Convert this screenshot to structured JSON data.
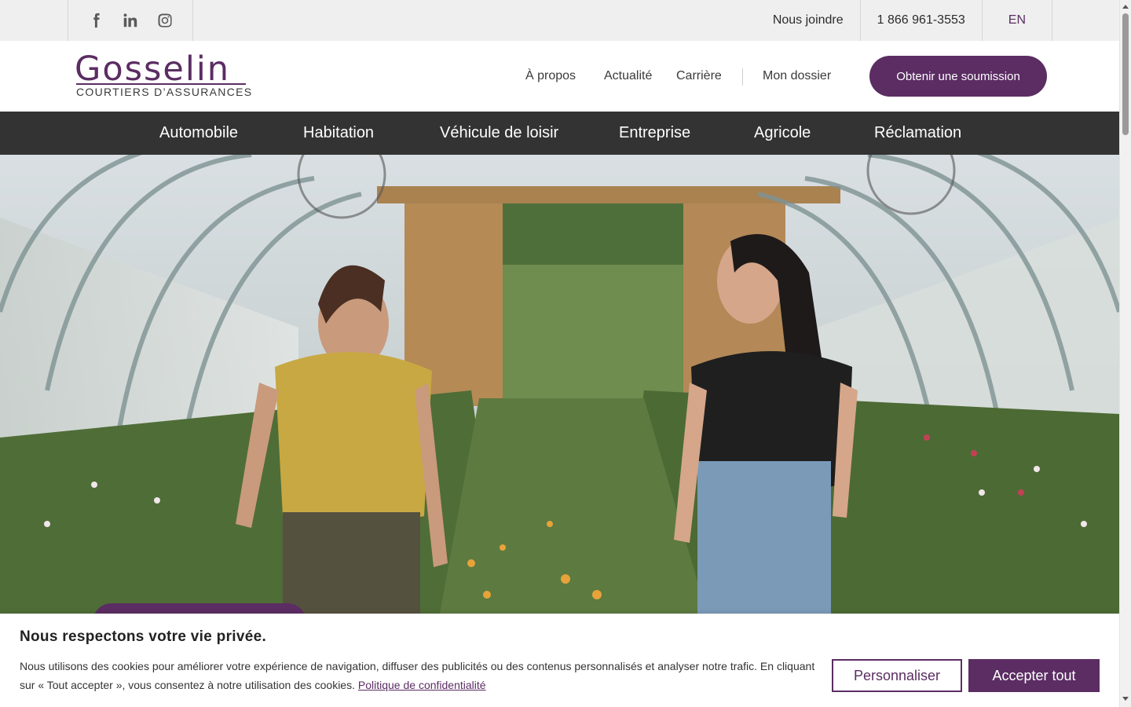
{
  "topbar": {
    "social": [
      {
        "icon": "facebook-icon"
      },
      {
        "icon": "linkedin-icon"
      },
      {
        "icon": "instagram-icon"
      }
    ],
    "contact_label": "Nous joindre",
    "phone": "1 866 961-3553",
    "language": "EN"
  },
  "header": {
    "logo_word": "Gosselin",
    "logo_sub": "COURTIERS D’ASSURANCES",
    "links": {
      "about": "À propos",
      "news": "Actualité",
      "career": "Carrière",
      "account": "Mon dossier"
    },
    "cta": "Obtenir une soumission"
  },
  "categories": {
    "auto": "Automobile",
    "home": "Habitation",
    "rv": "Véhicule de loisir",
    "business": "Entreprise",
    "farm": "Agricole",
    "claims": "Réclamation"
  },
  "cookie": {
    "title": "Nous respectons votre vie privée.",
    "text": "Nous utilisons des cookies pour améliorer votre expérience de navigation, diffuser des publicités ou des contenus personnalisés et analyser notre trafic. En cliquant sur « Tout accepter », vous consentez à notre utilisation des cookies.",
    "policy_link": "Politique de confidentialité",
    "customize": "Personnaliser",
    "accept": "Accepter tout"
  },
  "colors": {
    "brand": "#5b2d63",
    "nav_bg": "#333333",
    "topbar_bg": "#efefef"
  }
}
